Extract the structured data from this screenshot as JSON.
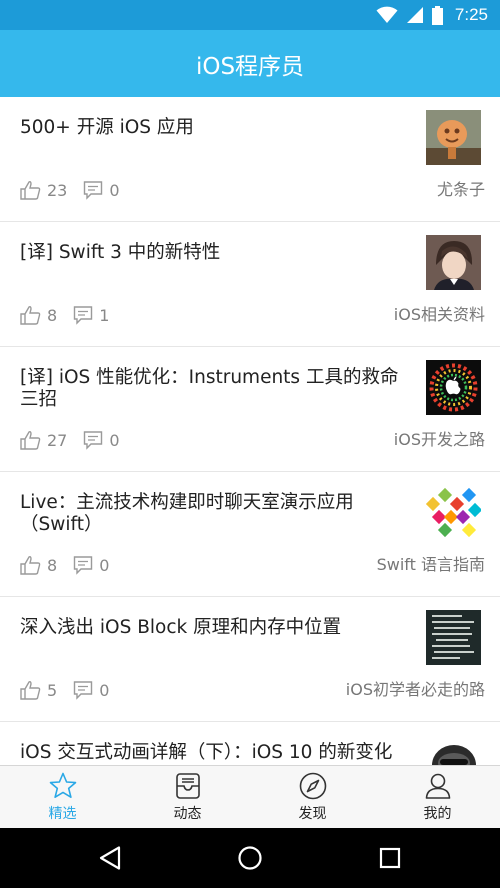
{
  "status_bar": {
    "time": "7:25",
    "icons": [
      "wifi-icon",
      "signal-icon",
      "battery-icon"
    ]
  },
  "app_bar": {
    "title": "iOS程序员"
  },
  "feed": {
    "items": [
      {
        "title": "500+ 开源 iOS 应用",
        "likes": "23",
        "comments": "0",
        "source": "尤条子",
        "thumb": "character-thumbnail"
      },
      {
        "title": "[译] Swift 3 中的新特性",
        "likes": "8",
        "comments": "1",
        "source": "iOS相关资料",
        "thumb": "portrait-thumbnail"
      },
      {
        "title": "[译] iOS 性能优化：Instruments 工具的救命三招",
        "likes": "27",
        "comments": "0",
        "source": "iOS开发之路",
        "thumb": "apple-logo-thumbnail"
      },
      {
        "title": "Live：主流技术构建即时聊天室演示应用（Swift）",
        "likes": "8",
        "comments": "0",
        "source": "Swift 语言指南",
        "thumb": "colorful-blocks-thumbnail"
      },
      {
        "title": "深入浅出 iOS Block 原理和内存中位置",
        "likes": "5",
        "comments": "0",
        "source": "iOS初学者必走的路",
        "thumb": "dark-text-thumbnail"
      },
      {
        "title": "iOS 交互式动画详解（下）：iOS 10 的新变化",
        "likes": "",
        "comments": "",
        "source": "",
        "thumb": "helmet-thumbnail"
      }
    ]
  },
  "tab_bar": {
    "tabs": [
      {
        "label": "精选",
        "icon": "star-icon",
        "active": true
      },
      {
        "label": "动态",
        "icon": "inbox-icon",
        "active": false
      },
      {
        "label": "发现",
        "icon": "compass-icon",
        "active": false
      },
      {
        "label": "我的",
        "icon": "person-icon",
        "active": false
      }
    ]
  },
  "nav_bar": {
    "buttons": [
      "back-icon",
      "home-icon",
      "recents-icon"
    ]
  },
  "colors": {
    "status_bar": "#1d9bd8",
    "app_bar": "#35b8ec",
    "active_tab": "#2aa8e6"
  }
}
